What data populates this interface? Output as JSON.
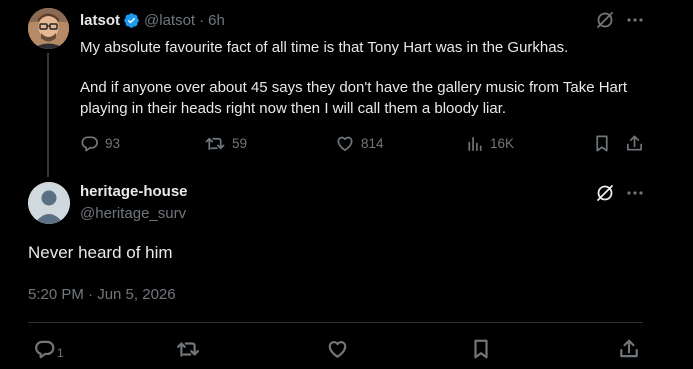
{
  "parent": {
    "display_name": "latsot",
    "handle": "@latsot",
    "separator": "·",
    "time_ago": "6h",
    "body_paragraphs": [
      "My absolute favourite fact of all time is that Tony Hart was in the Gurkhas.",
      "And if anyone over about 45 says they don't have the gallery music from Take Hart playing in their heads right now then I will call them a bloody liar."
    ],
    "actions": {
      "replies": "93",
      "reposts": "59",
      "likes": "814",
      "views": "16K"
    }
  },
  "reply": {
    "display_name": "heritage-house",
    "handle": "@heritage_surv",
    "text": "Never heard of him",
    "timestamp": "5:20 PM · Jun 5, 2026",
    "actions": {
      "replies": "1"
    }
  },
  "colors": {
    "background": "#000000",
    "text_primary": "#e7e9ea",
    "text_secondary": "#71767b",
    "verified": "#1d9bf0",
    "divider": "#2f3336"
  },
  "icons": [
    "grok-icon",
    "more-icon",
    "reply-icon",
    "repost-icon",
    "like-icon",
    "views-icon",
    "bookmark-icon",
    "share-icon",
    "verified-badge-icon"
  ]
}
